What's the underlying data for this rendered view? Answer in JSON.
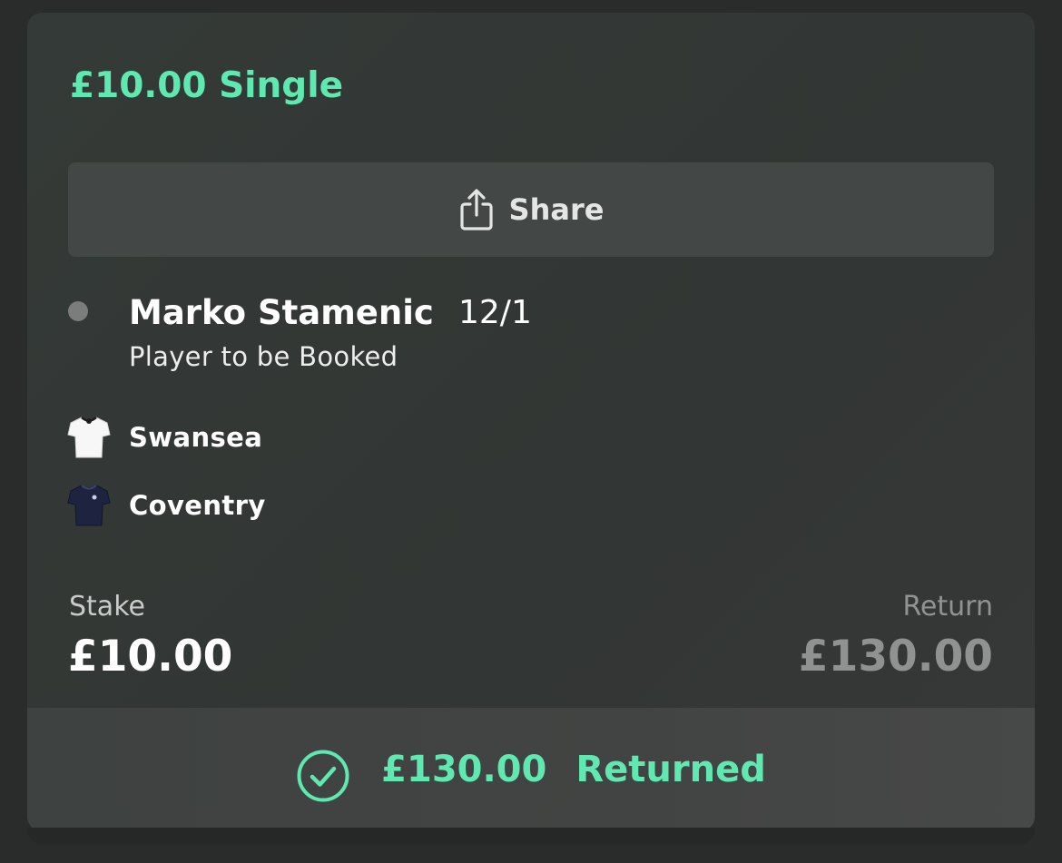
{
  "bet": {
    "title": "£10.00 Single"
  },
  "share": {
    "label": "Share",
    "icon": "share-icon"
  },
  "selection": {
    "name": "Marko Stamenic",
    "odds": "12/1",
    "market": "Player to be Booked"
  },
  "teams": [
    {
      "name": "Swansea",
      "icon": "white-shirt-icon"
    },
    {
      "name": "Coventry",
      "icon": "navy-shirt-icon"
    }
  ],
  "stake": {
    "label": "Stake",
    "value": "£10.00"
  },
  "return": {
    "label": "Return",
    "value": "£130.00"
  },
  "footer": {
    "amount": "£130.00",
    "status": "Returned",
    "icon": "check-circle-icon"
  },
  "colors": {
    "accent": "#5fe9b0",
    "card_background": "#333835",
    "share_button": "#434846",
    "footer_background": "#424443"
  }
}
